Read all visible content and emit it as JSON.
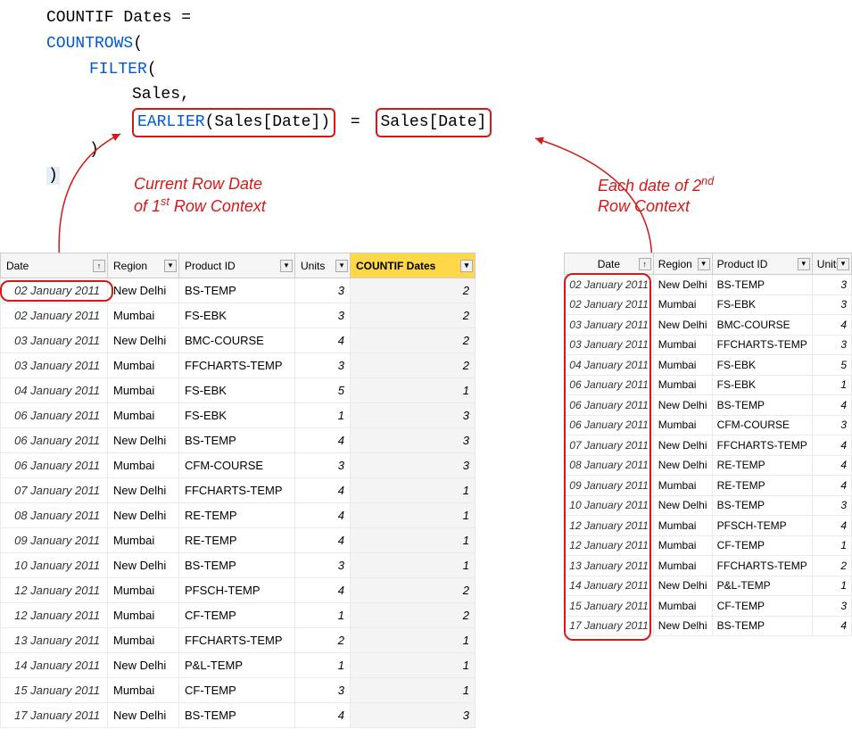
{
  "formula": {
    "line1a": "COUNTIF Dates =",
    "line2kw": "COUNTROWS",
    "line2p": "(",
    "line3kw": "FILTER",
    "line3p": "(",
    "line4": "Sales,",
    "line5kw": "EARLIER",
    "line5arg": "(Sales[Date])",
    "line5eq": "=",
    "line5right": "Sales[Date]",
    "line6": ")",
    "line7": ")"
  },
  "annotation1_l1": "Current Row Date",
  "annotation1_l2": "of 1",
  "annotation1_sup": "st",
  "annotation1_l2b": "  Row Context",
  "annotation2_l1": "Each date of 2",
  "annotation2_sup": "nd",
  "annotation2_l2": "Row Context",
  "left_table": {
    "headers": [
      "Date",
      "Region",
      "Product ID",
      "Units",
      "COUNTIF Dates"
    ],
    "rows": [
      {
        "date": "02 January 2011",
        "region": "New Delhi",
        "pid": "BS-TEMP",
        "units": "3",
        "c": "2"
      },
      {
        "date": "02 January 2011",
        "region": "Mumbai",
        "pid": "FS-EBK",
        "units": "3",
        "c": "2"
      },
      {
        "date": "03 January 2011",
        "region": "New Delhi",
        "pid": "BMC-COURSE",
        "units": "4",
        "c": "2"
      },
      {
        "date": "03 January 2011",
        "region": "Mumbai",
        "pid": "FFCHARTS-TEMP",
        "units": "3",
        "c": "2"
      },
      {
        "date": "04 January 2011",
        "region": "Mumbai",
        "pid": "FS-EBK",
        "units": "5",
        "c": "1"
      },
      {
        "date": "06 January 2011",
        "region": "Mumbai",
        "pid": "FS-EBK",
        "units": "1",
        "c": "3"
      },
      {
        "date": "06 January 2011",
        "region": "New Delhi",
        "pid": "BS-TEMP",
        "units": "4",
        "c": "3"
      },
      {
        "date": "06 January 2011",
        "region": "Mumbai",
        "pid": "CFM-COURSE",
        "units": "3",
        "c": "3"
      },
      {
        "date": "07 January 2011",
        "region": "New Delhi",
        "pid": "FFCHARTS-TEMP",
        "units": "4",
        "c": "1"
      },
      {
        "date": "08 January 2011",
        "region": "New Delhi",
        "pid": "RE-TEMP",
        "units": "4",
        "c": "1"
      },
      {
        "date": "09 January 2011",
        "region": "Mumbai",
        "pid": "RE-TEMP",
        "units": "4",
        "c": "1"
      },
      {
        "date": "10 January 2011",
        "region": "New Delhi",
        "pid": "BS-TEMP",
        "units": "3",
        "c": "1"
      },
      {
        "date": "12 January 2011",
        "region": "Mumbai",
        "pid": "PFSCH-TEMP",
        "units": "4",
        "c": "2"
      },
      {
        "date": "12 January 2011",
        "region": "Mumbai",
        "pid": "CF-TEMP",
        "units": "1",
        "c": "2"
      },
      {
        "date": "13 January 2011",
        "region": "Mumbai",
        "pid": "FFCHARTS-TEMP",
        "units": "2",
        "c": "1"
      },
      {
        "date": "14 January 2011",
        "region": "New Delhi",
        "pid": "P&L-TEMP",
        "units": "1",
        "c": "1"
      },
      {
        "date": "15 January 2011",
        "region": "Mumbai",
        "pid": "CF-TEMP",
        "units": "3",
        "c": "1"
      },
      {
        "date": "17 January 2011",
        "region": "New Delhi",
        "pid": "BS-TEMP",
        "units": "4",
        "c": "3"
      }
    ]
  },
  "right_table": {
    "headers": [
      "Date",
      "Region",
      "Product ID",
      "Units"
    ],
    "rows": [
      {
        "date": "02 January 2011",
        "region": "New Delhi",
        "pid": "BS-TEMP",
        "units": "3"
      },
      {
        "date": "02 January 2011",
        "region": "Mumbai",
        "pid": "FS-EBK",
        "units": "3"
      },
      {
        "date": "03 January 2011",
        "region": "New Delhi",
        "pid": "BMC-COURSE",
        "units": "4"
      },
      {
        "date": "03 January 2011",
        "region": "Mumbai",
        "pid": "FFCHARTS-TEMP",
        "units": "3"
      },
      {
        "date": "04 January 2011",
        "region": "Mumbai",
        "pid": "FS-EBK",
        "units": "5"
      },
      {
        "date": "06 January 2011",
        "region": "Mumbai",
        "pid": "FS-EBK",
        "units": "1"
      },
      {
        "date": "06 January 2011",
        "region": "New Delhi",
        "pid": "BS-TEMP",
        "units": "4"
      },
      {
        "date": "06 January 2011",
        "region": "Mumbai",
        "pid": "CFM-COURSE",
        "units": "3"
      },
      {
        "date": "07 January 2011",
        "region": "New Delhi",
        "pid": "FFCHARTS-TEMP",
        "units": "4"
      },
      {
        "date": "08 January 2011",
        "region": "New Delhi",
        "pid": "RE-TEMP",
        "units": "4"
      },
      {
        "date": "09 January 2011",
        "region": "Mumbai",
        "pid": "RE-TEMP",
        "units": "4"
      },
      {
        "date": "10 January 2011",
        "region": "New Delhi",
        "pid": "BS-TEMP",
        "units": "3"
      },
      {
        "date": "12 January 2011",
        "region": "Mumbai",
        "pid": "PFSCH-TEMP",
        "units": "4"
      },
      {
        "date": "12 January 2011",
        "region": "Mumbai",
        "pid": "CF-TEMP",
        "units": "1"
      },
      {
        "date": "13 January 2011",
        "region": "Mumbai",
        "pid": "FFCHARTS-TEMP",
        "units": "2"
      },
      {
        "date": "14 January 2011",
        "region": "New Delhi",
        "pid": "P&L-TEMP",
        "units": "1"
      },
      {
        "date": "15 January 2011",
        "region": "Mumbai",
        "pid": "CF-TEMP",
        "units": "3"
      },
      {
        "date": "17 January 2011",
        "region": "New Delhi",
        "pid": "BS-TEMP",
        "units": "4"
      }
    ]
  }
}
